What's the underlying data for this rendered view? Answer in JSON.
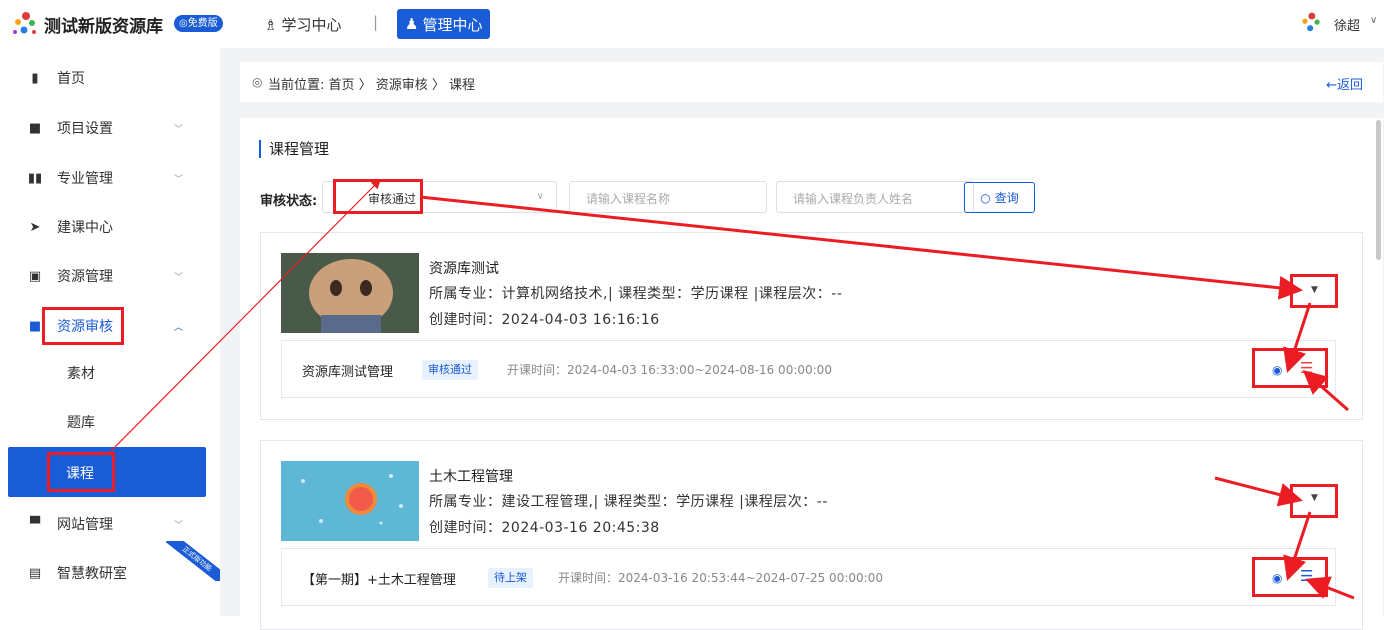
{
  "header": {
    "brand": "测试新版资源库",
    "free_badge": "免费版",
    "nav_learn": "学习中心",
    "nav_sep": "|",
    "nav_admin": "管理中心",
    "user_name": "徐超",
    "user_caret": "∨"
  },
  "sidebar": {
    "items": [
      {
        "label": "首页",
        "icon": "home-icon"
      },
      {
        "label": "项目设置",
        "icon": "folder-icon"
      },
      {
        "label": "专业管理",
        "icon": "book-icon"
      },
      {
        "label": "建课中心",
        "icon": "send-icon"
      },
      {
        "label": "资源管理",
        "icon": "archive-icon"
      },
      {
        "label": "资源审核",
        "icon": "audit-icon"
      },
      {
        "label": "网站管理",
        "icon": "monitor-icon"
      },
      {
        "label": "智慧教研室",
        "icon": "file-icon"
      }
    ],
    "sub_items": [
      "素材",
      "题库",
      "课程"
    ],
    "ribbon": "正式版功能"
  },
  "breadcrumb": {
    "text": "当前位置:  首页  〉 资源审核  〉 课程",
    "back": "←返回"
  },
  "panel": {
    "title": "课程管理",
    "filter_label": "审核状态:",
    "status_value": "审核通过",
    "course_name_placeholder": "请输入课程名称",
    "owner_placeholder": "请输入课程负责人姓名",
    "query_label": "查询"
  },
  "courses": [
    {
      "title": "资源库测试",
      "meta": "所属专业：计算机网络技术,| 课程类型：学历课程 |课程层次：--",
      "created": "创建时间：2024-04-03 16:16:16",
      "sub_name": "资源库测试管理",
      "sub_status": "审核通过",
      "sub_time": "开课时间：2024-04-03 16:33:00~2024-08-16 00:00:00"
    },
    {
      "title": "土木工程管理",
      "meta": "所属专业：建设工程管理,| 课程类型：学历课程 |课程层次：--",
      "created": "创建时间：2024-03-16 20:45:38",
      "sub_name": "【第一期】+土木工程管理",
      "sub_status": "待上架",
      "sub_time": "开课时间：2024-03-16 20:53:44~2024-07-25 00:00:00"
    }
  ],
  "colors": {
    "primary": "#1a5cd6",
    "annotation": "#ec1c24"
  }
}
